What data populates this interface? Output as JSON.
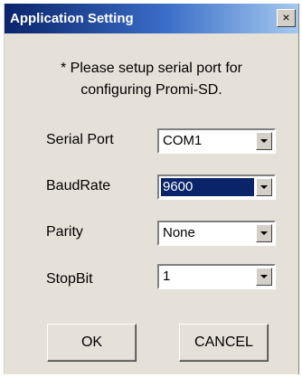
{
  "window": {
    "title": "Application Setting",
    "close_glyph": "×"
  },
  "message": {
    "line1": "* Please setup serial port for",
    "line2": "configuring Promi-SD."
  },
  "fields": {
    "serial_port": {
      "label": "Serial Port",
      "value": "COM1"
    },
    "baud_rate": {
      "label": "BaudRate",
      "value": "9600"
    },
    "parity": {
      "label": "Parity",
      "value": "None"
    },
    "stop_bit": {
      "label": "StopBit",
      "value": "1"
    }
  },
  "buttons": {
    "ok": "OK",
    "cancel": "CANCEL"
  },
  "icons": {
    "close": "close-icon",
    "dropdown": "chevron-down-icon"
  },
  "colors": {
    "titlebar_start": "#0a246a",
    "titlebar_end": "#a6caf0",
    "dialog_bg": "#e6e1d8",
    "selection": "#0a246a"
  }
}
